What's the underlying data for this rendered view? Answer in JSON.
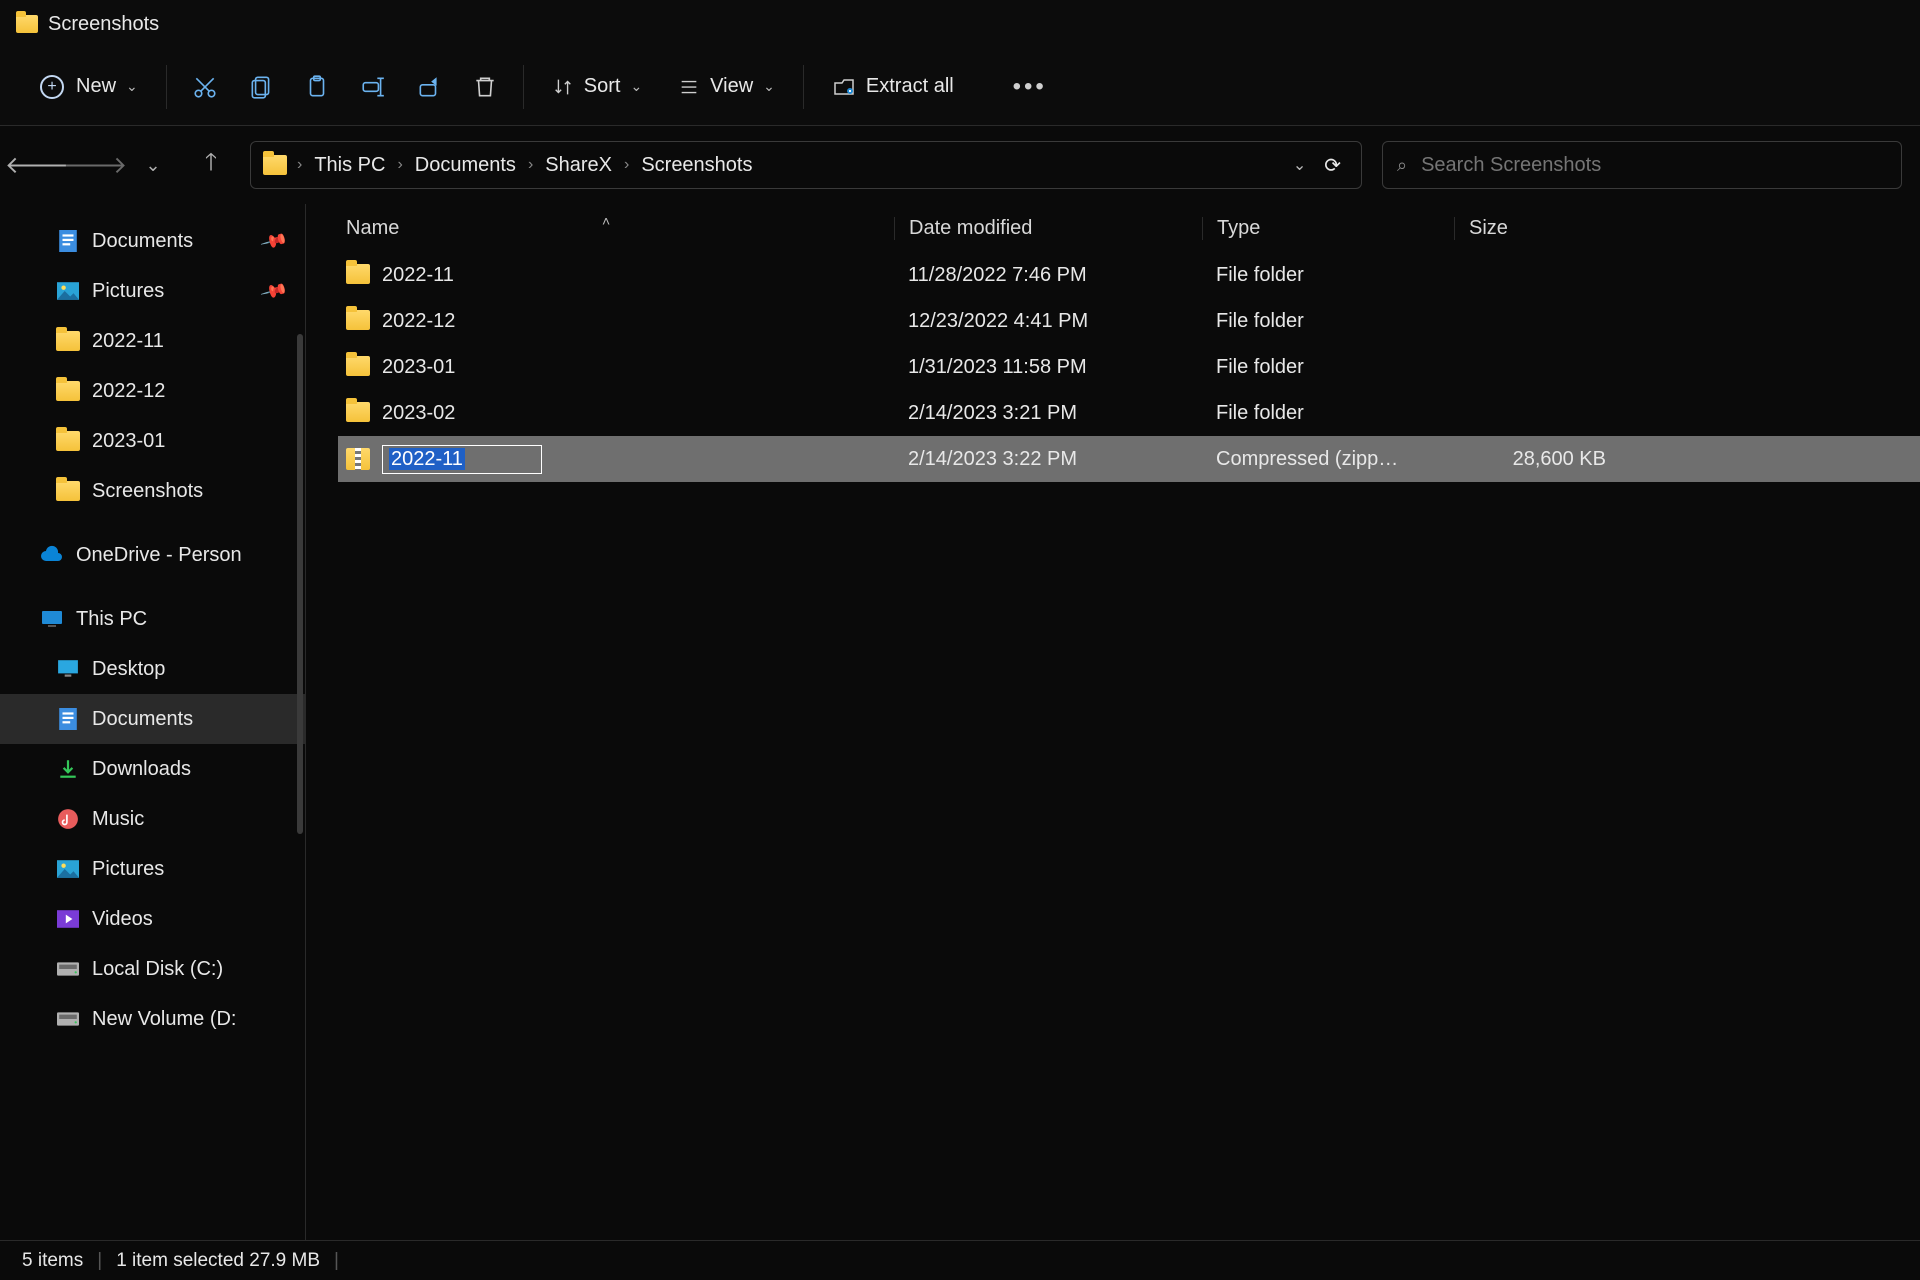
{
  "window_title": "Screenshots",
  "toolbar": {
    "new_label": "New",
    "sort_label": "Sort",
    "view_label": "View",
    "extract_label": "Extract all"
  },
  "breadcrumbs": [
    "This PC",
    "Documents",
    "ShareX",
    "Screenshots"
  ],
  "search_placeholder": "Search Screenshots",
  "columns": {
    "name": "Name",
    "date": "Date modified",
    "type": "Type",
    "size": "Size"
  },
  "sidebar": {
    "quick": [
      {
        "label": "Documents",
        "icon": "doc",
        "pinned": true
      },
      {
        "label": "Pictures",
        "icon": "pic",
        "pinned": true
      },
      {
        "label": "2022-11",
        "icon": "folder"
      },
      {
        "label": "2022-12",
        "icon": "folder"
      },
      {
        "label": "2023-01",
        "icon": "folder"
      },
      {
        "label": "Screenshots",
        "icon": "folder"
      }
    ],
    "onedrive_label": "OneDrive - Person",
    "thispc_label": "This PC",
    "thispc": [
      {
        "label": "Desktop",
        "icon": "desktop"
      },
      {
        "label": "Documents",
        "icon": "doc",
        "selected": true
      },
      {
        "label": "Downloads",
        "icon": "download"
      },
      {
        "label": "Music",
        "icon": "music"
      },
      {
        "label": "Pictures",
        "icon": "pic"
      },
      {
        "label": "Videos",
        "icon": "video"
      },
      {
        "label": "Local Disk (C:)",
        "icon": "drive"
      },
      {
        "label": "New Volume (D:",
        "icon": "drive"
      }
    ]
  },
  "rows": [
    {
      "name": "2022-11",
      "date": "11/28/2022 7:46 PM",
      "type": "File folder",
      "size": "",
      "icon": "folder"
    },
    {
      "name": "2022-12",
      "date": "12/23/2022 4:41 PM",
      "type": "File folder",
      "size": "",
      "icon": "folder"
    },
    {
      "name": "2023-01",
      "date": "1/31/2023 11:58 PM",
      "type": "File folder",
      "size": "",
      "icon": "folder"
    },
    {
      "name": "2023-02",
      "date": "2/14/2023 3:21 PM",
      "type": "File folder",
      "size": "",
      "icon": "folder"
    },
    {
      "name": "2022-11",
      "date": "2/14/2023 3:22 PM",
      "type": "Compressed (zipp…",
      "size": "28,600 KB",
      "icon": "zip",
      "selected": true,
      "rename": true
    }
  ],
  "status": {
    "count": "5 items",
    "selection": "1 item selected  27.9 MB"
  }
}
